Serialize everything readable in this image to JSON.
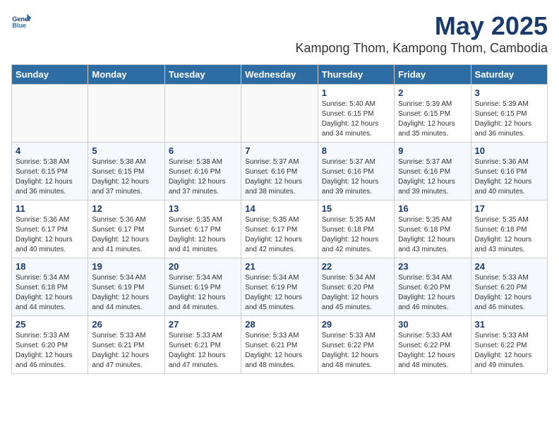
{
  "logo": {
    "name_line1": "General",
    "name_line2": "Blue"
  },
  "header": {
    "title": "May 2025",
    "subtitle": "Kampong Thom, Kampong Thom, Cambodia"
  },
  "days_of_week": [
    "Sunday",
    "Monday",
    "Tuesday",
    "Wednesday",
    "Thursday",
    "Friday",
    "Saturday"
  ],
  "weeks": [
    [
      {
        "day": "",
        "info": ""
      },
      {
        "day": "",
        "info": ""
      },
      {
        "day": "",
        "info": ""
      },
      {
        "day": "",
        "info": ""
      },
      {
        "day": "1",
        "info": "Sunrise: 5:40 AM\nSunset: 6:15 PM\nDaylight: 12 hours\nand 34 minutes."
      },
      {
        "day": "2",
        "info": "Sunrise: 5:39 AM\nSunset: 6:15 PM\nDaylight: 12 hours\nand 35 minutes."
      },
      {
        "day": "3",
        "info": "Sunrise: 5:39 AM\nSunset: 6:15 PM\nDaylight: 12 hours\nand 36 minutes."
      }
    ],
    [
      {
        "day": "4",
        "info": "Sunrise: 5:38 AM\nSunset: 6:15 PM\nDaylight: 12 hours\nand 36 minutes."
      },
      {
        "day": "5",
        "info": "Sunrise: 5:38 AM\nSunset: 6:15 PM\nDaylight: 12 hours\nand 37 minutes."
      },
      {
        "day": "6",
        "info": "Sunrise: 5:38 AM\nSunset: 6:16 PM\nDaylight: 12 hours\nand 37 minutes."
      },
      {
        "day": "7",
        "info": "Sunrise: 5:37 AM\nSunset: 6:16 PM\nDaylight: 12 hours\nand 38 minutes."
      },
      {
        "day": "8",
        "info": "Sunrise: 5:37 AM\nSunset: 6:16 PM\nDaylight: 12 hours\nand 39 minutes."
      },
      {
        "day": "9",
        "info": "Sunrise: 5:37 AM\nSunset: 6:16 PM\nDaylight: 12 hours\nand 39 minutes."
      },
      {
        "day": "10",
        "info": "Sunrise: 5:36 AM\nSunset: 6:16 PM\nDaylight: 12 hours\nand 40 minutes."
      }
    ],
    [
      {
        "day": "11",
        "info": "Sunrise: 5:36 AM\nSunset: 6:17 PM\nDaylight: 12 hours\nand 40 minutes."
      },
      {
        "day": "12",
        "info": "Sunrise: 5:36 AM\nSunset: 6:17 PM\nDaylight: 12 hours\nand 41 minutes."
      },
      {
        "day": "13",
        "info": "Sunrise: 5:35 AM\nSunset: 6:17 PM\nDaylight: 12 hours\nand 41 minutes."
      },
      {
        "day": "14",
        "info": "Sunrise: 5:35 AM\nSunset: 6:17 PM\nDaylight: 12 hours\nand 42 minutes."
      },
      {
        "day": "15",
        "info": "Sunrise: 5:35 AM\nSunset: 6:18 PM\nDaylight: 12 hours\nand 42 minutes."
      },
      {
        "day": "16",
        "info": "Sunrise: 5:35 AM\nSunset: 6:18 PM\nDaylight: 12 hours\nand 43 minutes."
      },
      {
        "day": "17",
        "info": "Sunrise: 5:35 AM\nSunset: 6:18 PM\nDaylight: 12 hours\nand 43 minutes."
      }
    ],
    [
      {
        "day": "18",
        "info": "Sunrise: 5:34 AM\nSunset: 6:18 PM\nDaylight: 12 hours\nand 44 minutes."
      },
      {
        "day": "19",
        "info": "Sunrise: 5:34 AM\nSunset: 6:19 PM\nDaylight: 12 hours\nand 44 minutes."
      },
      {
        "day": "20",
        "info": "Sunrise: 5:34 AM\nSunset: 6:19 PM\nDaylight: 12 hours\nand 44 minutes."
      },
      {
        "day": "21",
        "info": "Sunrise: 5:34 AM\nSunset: 6:19 PM\nDaylight: 12 hours\nand 45 minutes."
      },
      {
        "day": "22",
        "info": "Sunrise: 5:34 AM\nSunset: 6:20 PM\nDaylight: 12 hours\nand 45 minutes."
      },
      {
        "day": "23",
        "info": "Sunrise: 5:34 AM\nSunset: 6:20 PM\nDaylight: 12 hours\nand 46 minutes."
      },
      {
        "day": "24",
        "info": "Sunrise: 5:33 AM\nSunset: 6:20 PM\nDaylight: 12 hours\nand 46 minutes."
      }
    ],
    [
      {
        "day": "25",
        "info": "Sunrise: 5:33 AM\nSunset: 6:20 PM\nDaylight: 12 hours\nand 46 minutes."
      },
      {
        "day": "26",
        "info": "Sunrise: 5:33 AM\nSunset: 6:21 PM\nDaylight: 12 hours\nand 47 minutes."
      },
      {
        "day": "27",
        "info": "Sunrise: 5:33 AM\nSunset: 6:21 PM\nDaylight: 12 hours\nand 47 minutes."
      },
      {
        "day": "28",
        "info": "Sunrise: 5:33 AM\nSunset: 6:21 PM\nDaylight: 12 hours\nand 48 minutes."
      },
      {
        "day": "29",
        "info": "Sunrise: 5:33 AM\nSunset: 6:22 PM\nDaylight: 12 hours\nand 48 minutes."
      },
      {
        "day": "30",
        "info": "Sunrise: 5:33 AM\nSunset: 6:22 PM\nDaylight: 12 hours\nand 48 minutes."
      },
      {
        "day": "31",
        "info": "Sunrise: 5:33 AM\nSunset: 6:22 PM\nDaylight: 12 hours\nand 49 minutes."
      }
    ]
  ]
}
